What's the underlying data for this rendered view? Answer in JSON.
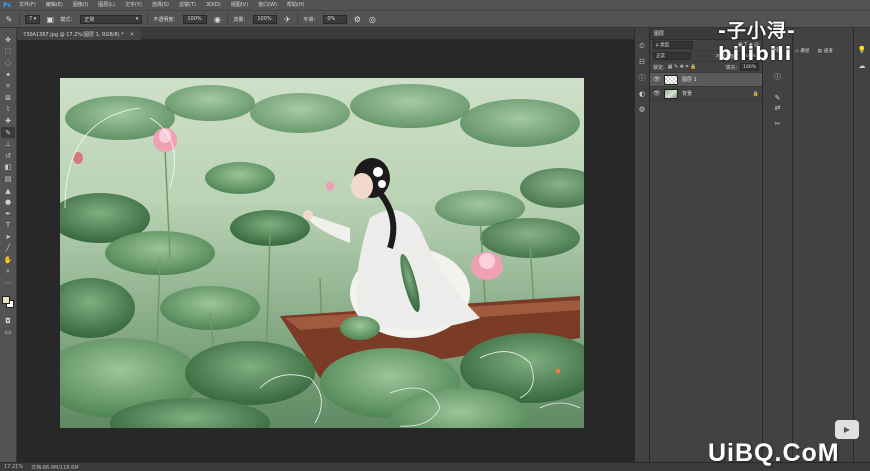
{
  "menubar": {
    "items": [
      "文件(F)",
      "编辑(E)",
      "图像(I)",
      "图层(L)",
      "文字(Y)",
      "选择(S)",
      "滤镜(T)",
      "3D(D)",
      "视图(V)",
      "窗口(W)",
      "帮助(H)"
    ]
  },
  "options": {
    "size": "7",
    "mode_label": "模式：",
    "mode_value": "正常",
    "opacity_label": "不透明度：",
    "opacity_value": "100%",
    "flow_label": "流量：",
    "flow_value": "100%",
    "smooth_label": "平滑：",
    "smooth_value": "0%"
  },
  "document": {
    "tab_title": "730A1367.jpg @ 17.2%(图层 1, RGB/8) *",
    "close": "×"
  },
  "status": {
    "zoom": "17.21%",
    "doc_size": "文档:86.9M/118.6M"
  },
  "layers_panel": {
    "title": "图层",
    "filter_kind": "p 类型",
    "blend_mode": "正常",
    "opacity_label": "不透明度:",
    "opacity_value": "100%",
    "lock_label": "锁定:",
    "fill_label": "填充:",
    "fill_value": "100%",
    "layers": [
      {
        "name": "图层 1",
        "selected": true
      },
      {
        "name": "背景",
        "selected": false
      }
    ]
  },
  "right_panels": {
    "paths_label": "路径",
    "channels_label": "通道"
  },
  "watermarks": {
    "top": "-子小浔-bilibili",
    "bottom": "UiBQ.CoM"
  },
  "colors": {
    "foreground": "#e8e3c0",
    "background": "#ffffff"
  }
}
